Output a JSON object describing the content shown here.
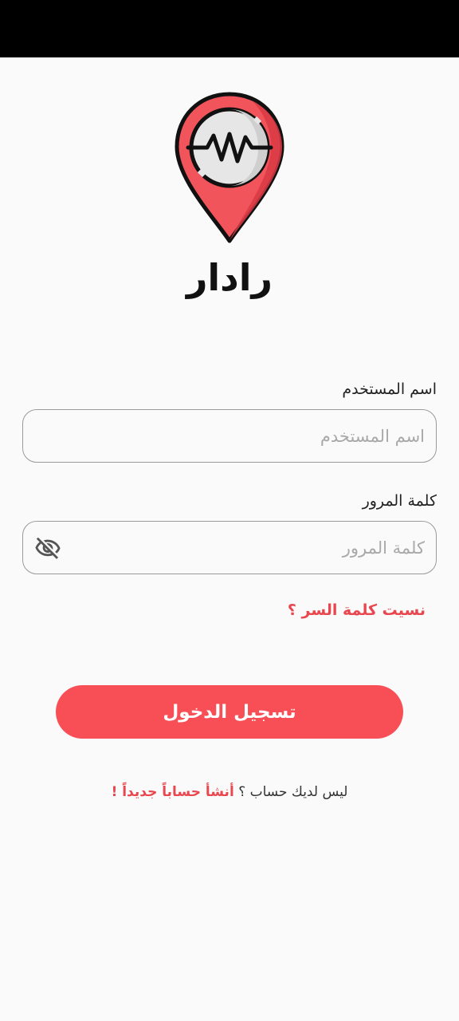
{
  "app": {
    "title": "رادار"
  },
  "form": {
    "username": {
      "label": "اسم المستخدم",
      "placeholder": "اسم المستخدم",
      "value": ""
    },
    "password": {
      "label": "كلمة المرور",
      "placeholder": "كلمة المرور",
      "value": "",
      "toggle_icon": "eye-off-icon"
    },
    "forgot_password": "نسيت كلمة السر ؟",
    "login_button": "تسجيل الدخول"
  },
  "signup": {
    "prompt": "ليس لديك حساب ؟",
    "link": "أنشأ حساباً جديداً !"
  },
  "colors": {
    "accent": "#f74f55",
    "link": "#e8474f",
    "background": "#fafafa",
    "status_bar": "#000000"
  },
  "icons": {
    "logo": "location-pin-pulse-icon"
  }
}
